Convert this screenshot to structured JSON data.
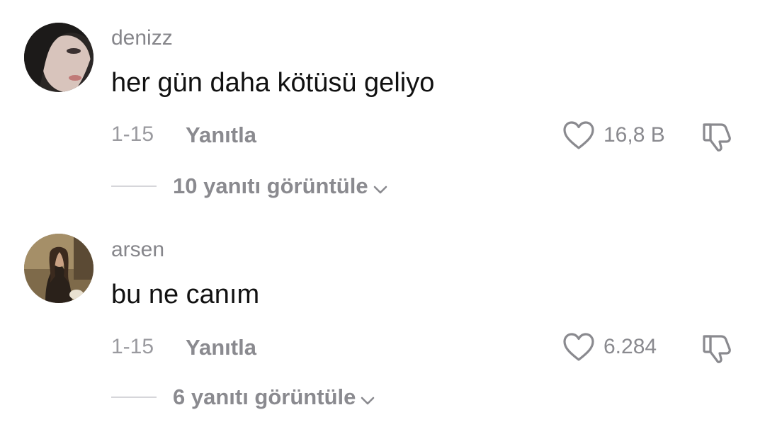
{
  "comments": [
    {
      "username": "denizz",
      "text": "her gün daha kötüsü geliyo",
      "date": "1-15",
      "reply_label": "Yanıtla",
      "likes": "16,8 B",
      "view_replies": "10 yanıtı görüntüle",
      "avatar": "avatar-photo-dark"
    },
    {
      "username": "arsen",
      "text": "bu ne canım",
      "date": "1-15",
      "reply_label": "Yanıtla",
      "likes": "6.284",
      "view_replies": "6 yanıtı görüntüle",
      "avatar": "avatar-photo-warm"
    }
  ],
  "icons": {
    "like": "heart-outline-icon",
    "dislike": "thumbs-down-outline-icon",
    "expand": "chevron-down-icon"
  },
  "colors": {
    "text": "#111111",
    "muted": "#8a8a8f",
    "divider": "#d6d6da"
  }
}
